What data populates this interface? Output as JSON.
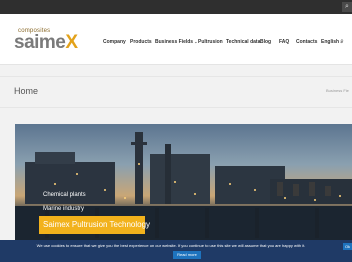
{
  "topbar": {
    "search_icon": "search-icon"
  },
  "logo": {
    "small_text": "composites",
    "main_text": "saime",
    "x_text": "X"
  },
  "nav": {
    "items": [
      {
        "label": "Company"
      },
      {
        "label": "Products"
      },
      {
        "label": "Business Fields",
        "caret": "⌄"
      },
      {
        "label": "Pultrusion"
      },
      {
        "label": "Technical data"
      },
      {
        "label": "Blog"
      },
      {
        "label": "FAQ"
      },
      {
        "label": "Contacts"
      },
      {
        "label": "English",
        "caret": "⌄"
      }
    ],
    "search_icon": "search-icon"
  },
  "page": {
    "title": "Home",
    "breadcrumb": "Business Fie"
  },
  "hero": {
    "caption1": "Chemical plants",
    "caption2": "Marine industry",
    "badge": "Saimex Pultrusion Technology"
  },
  "cookie": {
    "text": "We use cookies to ensure that we give you the best experience on our website. If you continue to use this site we will assume that you are happy with it.",
    "ok_label": "Ok",
    "read_more_label": "Read more"
  },
  "colors": {
    "accent": "#f2b21c",
    "cookie_bg": "#1f3a66",
    "button": "#1e73be",
    "topbar": "#2f2f2f"
  }
}
